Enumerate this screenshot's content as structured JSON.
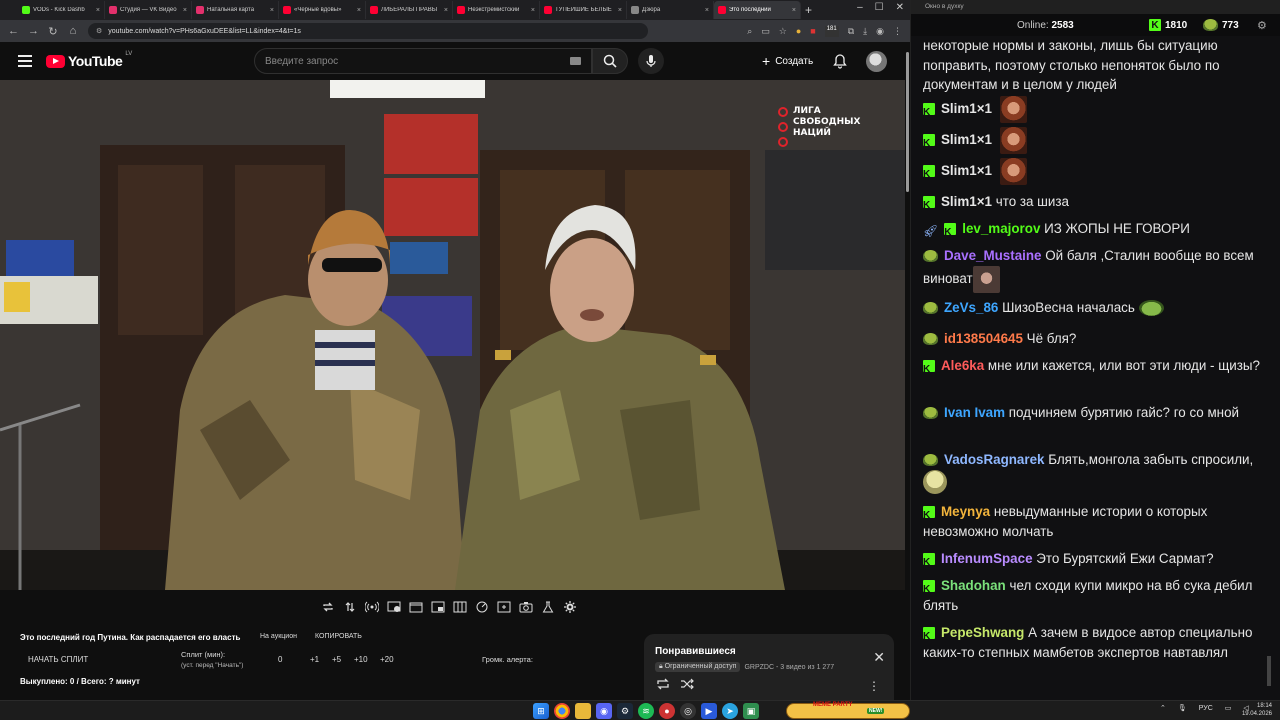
{
  "browser": {
    "tabs": [
      {
        "label": "VODs - Kick Dashb",
        "color": "#53fc18"
      },
      {
        "label": "Студия — VK Видео",
        "color": "#e3306c"
      },
      {
        "label": "Натальная карта",
        "color": "#e3306c"
      },
      {
        "label": "«Черные вдовы»",
        "color": "#ff0033"
      },
      {
        "label": "ЛИБЕРАЛЫ ПРАВЫ",
        "color": "#ff0033"
      },
      {
        "label": "Неэкстремистский",
        "color": "#ff0033"
      },
      {
        "label": "ТУПЕЙШИЕ БЕЛЫЕ",
        "color": "#ff0033"
      },
      {
        "label": "Дзюра",
        "color": "#888888"
      },
      {
        "label": "Это последний",
        "color": "#ff0033",
        "active": true
      }
    ],
    "url": "youtube.com/watch?v=PHs6aGxuDEE&list=LL&index=4&t=1s",
    "profile_badge": "181"
  },
  "youtube": {
    "logo_text": "YouTube",
    "country_code": "LV",
    "search_placeholder": "Введите запрос",
    "create_label": "Создать"
  },
  "video": {
    "watermark_lines": [
      "ЛИГА",
      "СВОБОДНЫХ",
      "НАЦИЙ"
    ],
    "title": "Это последний год Путина. Как распадается его власть"
  },
  "extension": {
    "auction_label": "На аукцион",
    "copy_label": "КОПИРОВАТЬ",
    "start_split_label": "НАЧАТЬ СПЛИТ",
    "split_min_label": "Сплит (мин):",
    "split_sub_label": "(уст. перед \"Начать\")",
    "split_value": "0",
    "increments": [
      "+1",
      "+5",
      "+10",
      "+20"
    ],
    "alert_volume_label": "Громк. алерта:",
    "bought_label": "Выкуплено: 0 / Всего: ? минут"
  },
  "liked_panel": {
    "title": "Понравившиеся",
    "access_label": "Ограниченный доступ",
    "meta": "GRPZDC - 3 видео из 1 277"
  },
  "chat": {
    "window_title": "Окно в духку",
    "online_label": "Online:",
    "online_count": "2583",
    "stat1": "1810",
    "stat2": "773",
    "messages": [
      {
        "user": "",
        "color": "#e6e6e6",
        "text": "некоторые нормы и законы, лишь бы ситуацию поправить, поэтому столько непоняток было по документам и в целом у людей",
        "badge": "none"
      },
      {
        "user": "Slim1×1",
        "color": "#e6e6e6",
        "text": "",
        "badge": "kick",
        "emote": "emote"
      },
      {
        "user": "Slim1×1",
        "color": "#e6e6e6",
        "text": "",
        "badge": "kick",
        "emote": "emote"
      },
      {
        "user": "Slim1×1",
        "color": "#e6e6e6",
        "text": "",
        "badge": "kick",
        "emote": "emote"
      },
      {
        "user": "Slim1×1",
        "color": "#e6e6e6",
        "text": "что за шиза",
        "badge": "kick"
      },
      {
        "user": "lev_majorov",
        "color": "#53fc18",
        "text": "ИЗ ЖОПЫ НЕ ГОВОРИ",
        "badge": "rocket-kick"
      },
      {
        "user": "Dave_Mustaine",
        "color": "#a970ff",
        "text": "Ой баля ,Сталин вообще во всем виноват",
        "badge": "pepe",
        "emote": "emote2"
      },
      {
        "user": "ZeVs_86",
        "color": "#3ea6ff",
        "text": "ШизоВесна началась",
        "badge": "pepe",
        "emote": "emote3"
      },
      {
        "user": "id138504645",
        "color": "#ff7a4a",
        "text": "Чё бля?",
        "badge": "pepe"
      },
      {
        "user": "Ale6ka",
        "color": "#ff5b5b",
        "text": "мне или кажется, или вот эти люди - щизы?",
        "badge": "kick"
      },
      {
        "user": "Ivan Ivam",
        "color": "#3ea6ff",
        "text": "подчиняем бурятию гайс? го со мной",
        "badge": "pepe"
      },
      {
        "user": "VadosRagnarek",
        "color": "#8fb8ff",
        "text": "Блять,монгола забыть спросили,",
        "badge": "pepe",
        "emote": "emote4"
      },
      {
        "user": "Meynya",
        "color": "#f2b43c",
        "text": "невыдуманные истории о которых невозможно молчать",
        "badge": "kick"
      },
      {
        "user": "InfenumSpace",
        "color": "#b98cff",
        "text": "Это Бурятский Ежи Сармат?",
        "badge": "kick"
      },
      {
        "user": "Shadohan",
        "color": "#7be07b",
        "text": "чел сходи купи микро на вб сука дебил блять",
        "badge": "kick"
      },
      {
        "user": "PepeShwang",
        "color": "#c6e86a",
        "text": "А зачем в видосе автор специально каких-то степных мамбетов экспертов навтавлял",
        "badge": "kick"
      }
    ]
  },
  "taskbar": {
    "meme_label": "MEME PARTY",
    "meme_badge": "NEW!",
    "lang": "РУС",
    "time": "18:14",
    "date": "19.04.2026"
  }
}
